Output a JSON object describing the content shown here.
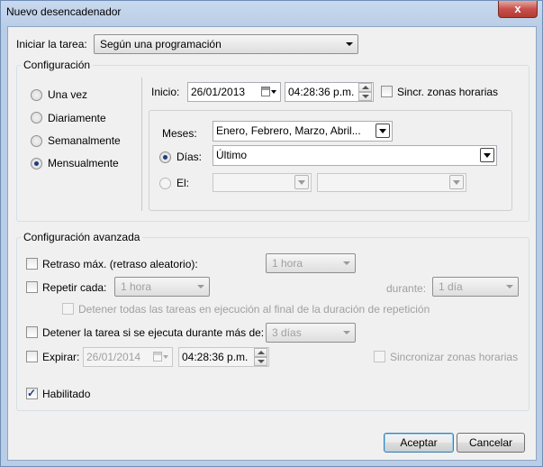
{
  "window": {
    "title": "Nuevo desencadenador",
    "close_label": "x"
  },
  "task": {
    "label": "Iniciar la tarea:",
    "value": "Según una programación"
  },
  "config": {
    "legend": "Configuración",
    "schedule_options": [
      "Una vez",
      "Diariamente",
      "Semanalmente",
      "Mensualmente"
    ],
    "selected_option": "Mensualmente",
    "start_label": "Inicio:",
    "start_date": "26/01/2013",
    "start_time": "04:28:36 p.m.",
    "sync_label": "Sincr. zonas horarias",
    "months_label": "Meses:",
    "months_value": "Enero, Febrero, Marzo, Abril...",
    "days_label": "Días:",
    "days_value": "Último",
    "on_label": "El:",
    "on_value1": "",
    "on_value2": ""
  },
  "advanced": {
    "legend": "Configuración avanzada",
    "delay_label": "Retraso máx. (retraso aleatorio):",
    "delay_value": "1 hora",
    "repeat_label": "Repetir cada:",
    "repeat_value": "1 hora",
    "duration_label": "durante:",
    "duration_value": "1 día",
    "stop_all_label": "Detener todas las tareas en ejecución al final de la duración de repetición",
    "stop_if_label": "Detener la tarea si se ejecuta durante más de:",
    "stop_if_value": "3 días",
    "expire_label": "Expirar:",
    "expire_date": "26/01/2014",
    "expire_time": "04:28:36 p.m.",
    "expire_sync_label": "Sincronizar zonas horarias",
    "enabled_label": "Habilitado",
    "enabled_checked": true
  },
  "buttons": {
    "ok": "Aceptar",
    "cancel": "Cancelar"
  }
}
